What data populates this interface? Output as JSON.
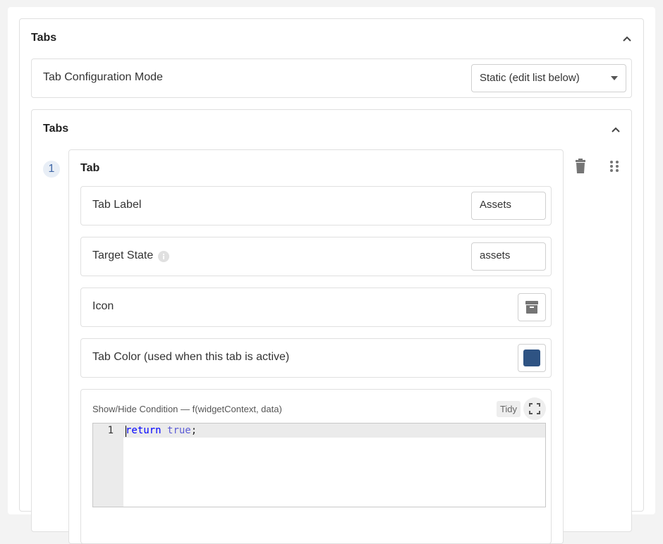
{
  "outer_section": {
    "title": "Tabs",
    "config_mode": {
      "label": "Tab Configuration Mode",
      "value": "Static (edit list below)"
    }
  },
  "tabs_section": {
    "title": "Tabs",
    "items": [
      {
        "index": "1",
        "title": "Tab",
        "fields": {
          "tab_label": {
            "label": "Tab Label",
            "value": "Assets"
          },
          "target_state": {
            "label": "Target State",
            "value": "assets"
          },
          "icon": {
            "label": "Icon",
            "icon_name": "archive-icon"
          },
          "tab_color": {
            "label": "Tab Color (used when this tab is active)",
            "color": "#2e5383"
          }
        },
        "condition": {
          "label": "Show/Hide Condition — f(widgetContext, data)",
          "tidy_label": "Tidy",
          "line_number": "1",
          "code_return": "return",
          "code_true": "true",
          "code_semicolon": ";"
        }
      }
    ]
  },
  "colors": {
    "accent": "#3f66a6",
    "swatch": "#2e5383"
  }
}
